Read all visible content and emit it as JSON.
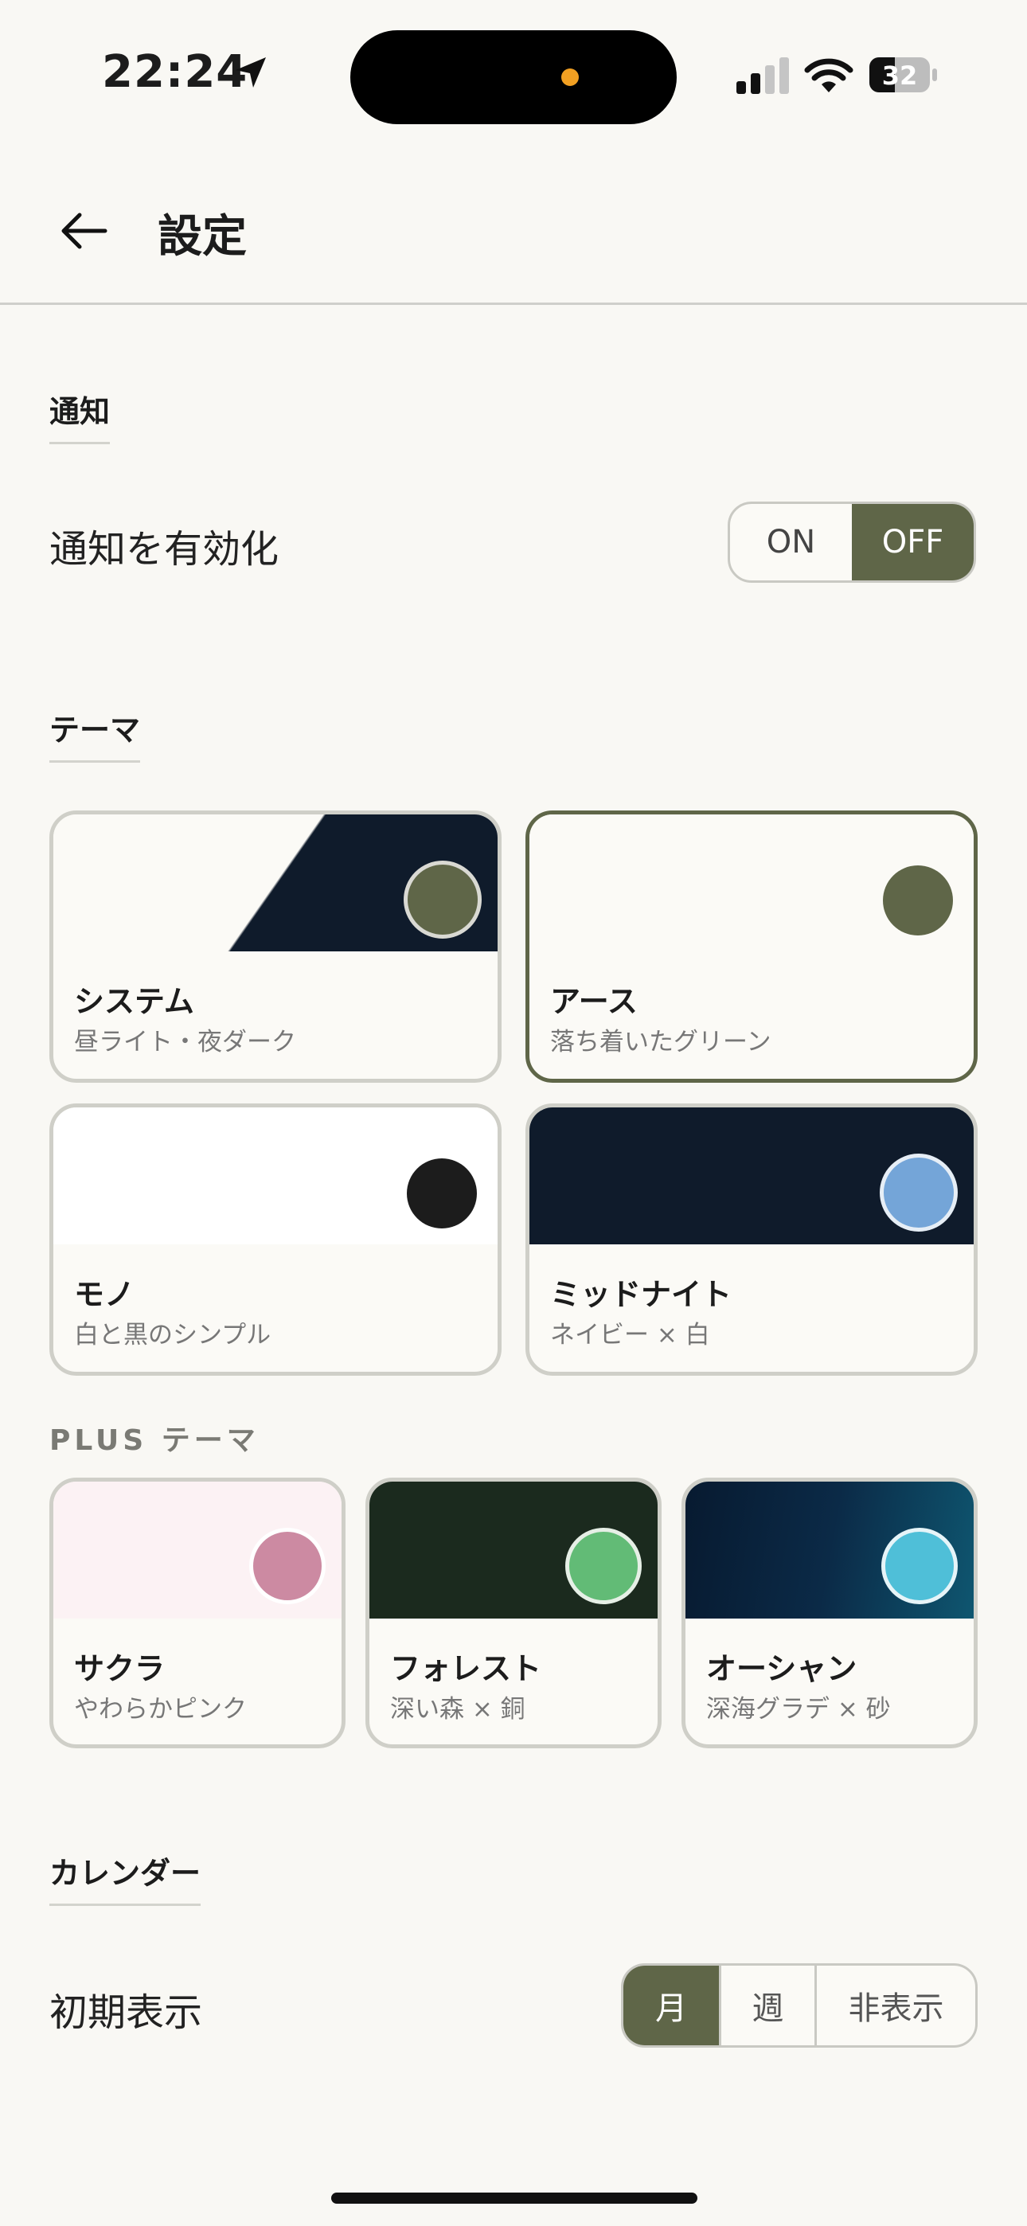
{
  "status_bar": {
    "time": "22:24",
    "battery": "32"
  },
  "header": {
    "title": "設定"
  },
  "notifications": {
    "section_title": "通知",
    "enable_label": "通知を有効化",
    "on_label": "ON",
    "off_label": "OFF",
    "selected": "OFF"
  },
  "theme": {
    "section_title": "テーマ",
    "items": [
      {
        "name": "システム",
        "desc": "昼ライト・夜ダーク",
        "band_color": "#0f1b2b",
        "swatch_color": "#5f6648",
        "selected": false
      },
      {
        "name": "アース",
        "desc": "落ち着いたグリーン",
        "band_color": "#fbfaf6",
        "swatch_color": "#5f6648",
        "selected": true
      },
      {
        "name": "モノ",
        "desc": "白と黒のシンプル",
        "band_color": "#ffffff",
        "swatch_color": "#1c1c1c",
        "selected": false
      },
      {
        "name": "ミッドナイト",
        "desc": "ネイビー × 白",
        "band_color": "#0f1b2b",
        "swatch_color": "#74a5d8",
        "selected": false
      }
    ]
  },
  "plus_theme": {
    "section_title": "PLUS テーマ",
    "items": [
      {
        "name": "サクラ",
        "desc": "やわらかピンク",
        "band_color": "#fcf2f4",
        "swatch_color": "#cc8aa2"
      },
      {
        "name": "フォレスト",
        "desc": "深い森 × 銅",
        "band_color": "#1b2a1e",
        "swatch_color": "#62bb76"
      },
      {
        "name": "オーシャン",
        "desc": "深海グラデ × 砂",
        "band_color": "#0b2a47",
        "swatch_color": "#4fbfd8"
      }
    ]
  },
  "calendar": {
    "section_title": "カレンダー",
    "default_view_label": "初期表示",
    "options": [
      "月",
      "週",
      "非表示"
    ],
    "selected": "月"
  },
  "colors": {
    "accent": "#5f6648",
    "background": "#f9f8f4",
    "border": "#cfcfc8"
  }
}
